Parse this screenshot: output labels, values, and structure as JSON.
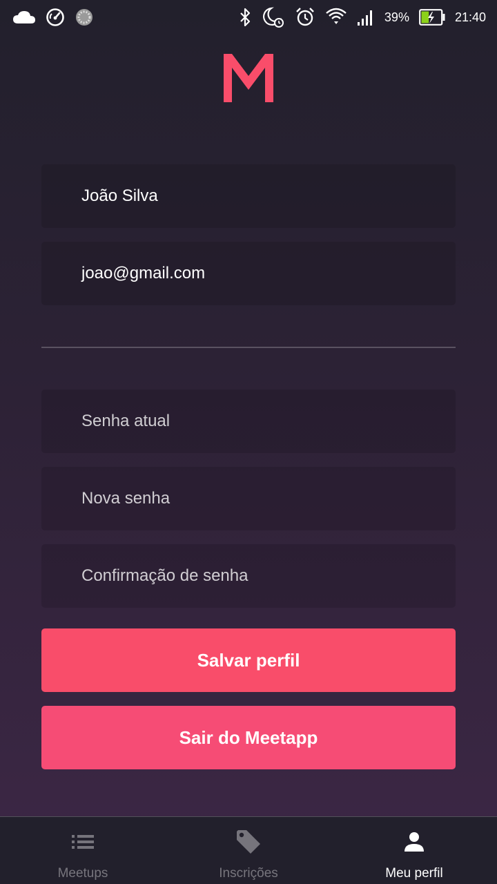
{
  "status_bar": {
    "battery_percent": "39%",
    "time": "21:40",
    "icons": [
      "cloud-icon",
      "speedometer-icon",
      "sync-icon",
      "bluetooth-icon",
      "moon-alarm-icon",
      "alarm-clock-icon",
      "wifi-icon",
      "signal-icon",
      "battery-charging-icon"
    ],
    "battery_level": 0.39
  },
  "brand": {
    "logo_icon": "meetapp-m-logo",
    "accent_color": "#f94d6a"
  },
  "profile_form": {
    "name_value": "João Silva",
    "email_value": "joao@gmail.com",
    "current_password_placeholder": "Senha atual",
    "new_password_placeholder": "Nova senha",
    "confirm_password_placeholder": "Confirmação de senha",
    "save_label": "Salvar perfil",
    "logout_label": "Sair do Meetapp"
  },
  "tab_bar": {
    "tabs": [
      {
        "label": "Meetups",
        "icon": "list-icon",
        "active": false
      },
      {
        "label": "Inscrições",
        "icon": "tag-icon",
        "active": false
      },
      {
        "label": "Meu perfil",
        "icon": "person-icon",
        "active": true
      }
    ]
  }
}
